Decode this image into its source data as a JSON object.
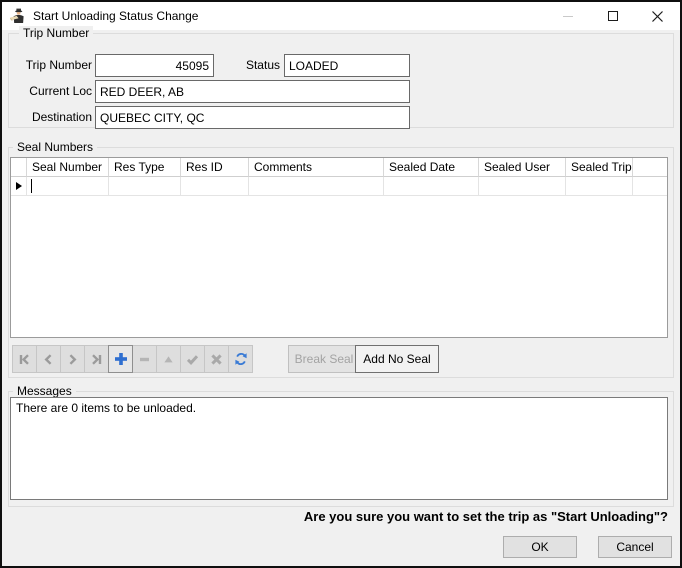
{
  "window": {
    "title": "Start Unloading Status Change",
    "titlebar_icon": "courier-person-icon",
    "controls": {
      "minimize": "minimize-icon",
      "maximize": "maximize-icon",
      "close": "close-icon"
    }
  },
  "trip_group": {
    "label": "Trip Number",
    "trip_number_label": "Trip Number",
    "trip_number_value": "45095",
    "status_label": "Status",
    "status_value": "LOADED",
    "current_loc_label": "Current Loc",
    "current_loc_value": "RED DEER, AB",
    "destination_label": "Destination",
    "destination_value": "QUEBEC CITY, QC"
  },
  "seal_group": {
    "label": "Seal Numbers",
    "columns": [
      "Seal Number",
      "Res Type",
      "Res ID",
      "Comments",
      "Sealed Date",
      "Sealed User",
      "Sealed Trip"
    ],
    "nav_icons": [
      "first-record-icon",
      "prior-record-icon",
      "next-record-icon",
      "last-record-icon",
      "insert-record-icon",
      "delete-record-icon",
      "edit-record-icon",
      "post-edit-icon",
      "cancel-edit-icon",
      "refresh-icon"
    ],
    "break_seal_label": "Break Seal",
    "add_no_seal_label": "Add No Seal"
  },
  "messages_group": {
    "label": "Messages",
    "text": "There are 0 items to be unloaded."
  },
  "footer": {
    "confirm_text": "Are you sure you want to set the trip as \"Start Unloading\"?",
    "ok_label": "OK",
    "cancel_label": "Cancel"
  },
  "colors": {
    "window_border": "#0f0f0f",
    "titlebar_bg": "#ffffff",
    "dialog_bg": "#f0f0f0",
    "groupbox_border": "#dcdcdc",
    "field_border": "#696969",
    "grid_border": "#9b9b9b",
    "accent_blue": "#2f6fd0",
    "nav_glyph_gray": "#9b9b9b",
    "disabled_gray": "#b5b5b5",
    "button_bg": "#e1e1e1",
    "button_border": "#adadad"
  }
}
